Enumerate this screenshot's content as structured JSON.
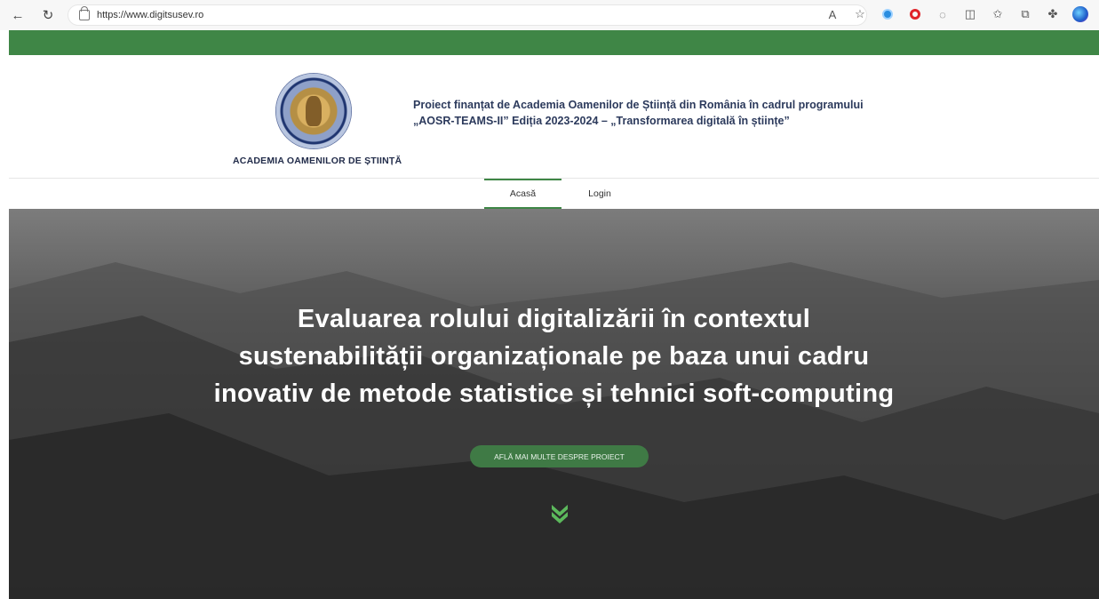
{
  "browser": {
    "url": "https://www.digitsusev.ro",
    "icons": [
      "back-arrow-icon",
      "reload-icon",
      "lock-icon",
      "read-aloud-icon",
      "favorite-star-icon",
      "extension-blue-icon",
      "opera-icon",
      "copilot-icon",
      "split-screen-icon",
      "favorites-icon",
      "collections-icon",
      "extensions-icon",
      "profile-icon"
    ]
  },
  "header": {
    "academy_name": "ACADEMIA OAMENILOR DE ȘTIINȚĂ",
    "funding_line1": "Proiect finanțat de Academia Oamenilor de Știință din România în cadrul programului",
    "funding_line2": "„AOSR-TEAMS-II” Ediția 2023-2024 – „Transformarea digitală în științe”"
  },
  "nav": {
    "items": [
      {
        "label": "Acasă",
        "active": true
      },
      {
        "label": "Login",
        "active": false
      }
    ]
  },
  "hero": {
    "title_line1": "Evaluarea rolului digitalizării în contextul",
    "title_line2": "sustenabilității organizaționale pe baza unui cadru",
    "title_line3": "inovativ de metode statistice și tehnici soft-computing",
    "button_label": "AFLĂ MAI MULTE DESPRE PROIECT"
  },
  "colors": {
    "brand_green": "#3f8646",
    "heading_navy": "#2c3a5c",
    "chevron_green": "#5cb85c"
  }
}
